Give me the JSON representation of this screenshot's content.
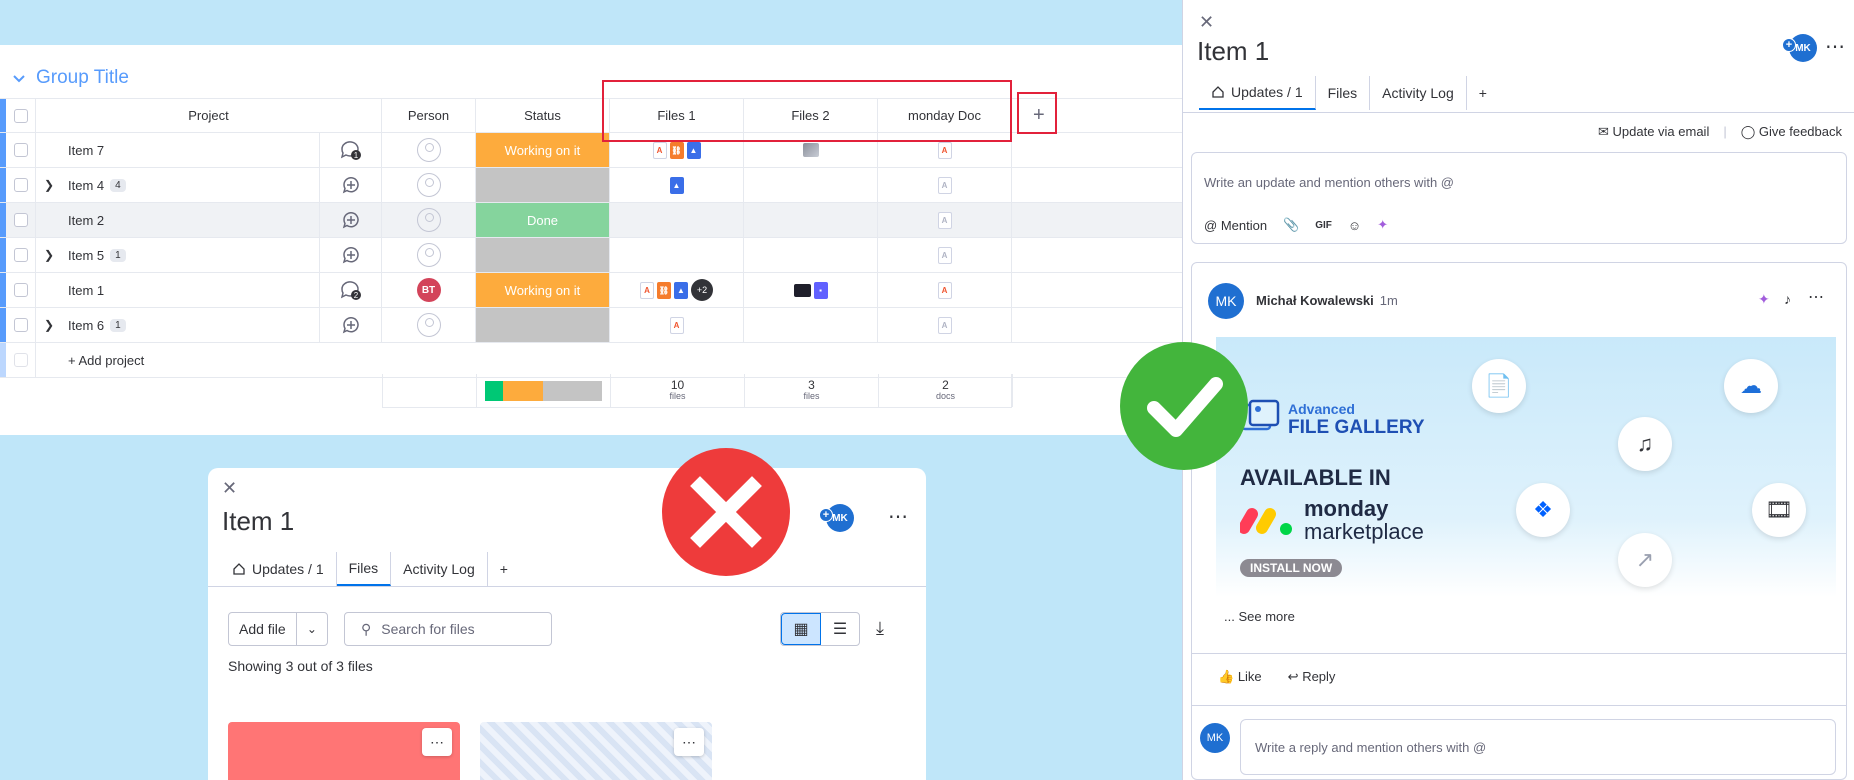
{
  "board": {
    "group_title": "Group Title",
    "columns": [
      "Project",
      "Person",
      "Status",
      "Files 1",
      "Files 2",
      "monday Doc"
    ],
    "rows": [
      {
        "name": "Item 7",
        "count": "",
        "expandable": false,
        "updates": "1",
        "person": "",
        "status": "Working on it"
      },
      {
        "name": "Item 4",
        "count": "4",
        "expandable": true,
        "updates": "",
        "person": "",
        "status": ""
      },
      {
        "name": "Item 2",
        "count": "",
        "expandable": false,
        "updates": "",
        "person": "",
        "status": "Done"
      },
      {
        "name": "Item 5",
        "count": "1",
        "expandable": true,
        "updates": "",
        "person": "",
        "status": ""
      },
      {
        "name": "Item 1",
        "count": "",
        "expandable": false,
        "updates": "2",
        "person": "BT",
        "status": "Working on it",
        "extra_files": "+2"
      },
      {
        "name": "Item 6",
        "count": "1",
        "expandable": true,
        "updates": "",
        "person": "",
        "status": ""
      }
    ],
    "add_project": "+ Add project",
    "footer": {
      "files1_count": "10",
      "files1_unit": "files",
      "files2_count": "3",
      "files2_unit": "files",
      "doc_count": "2",
      "doc_unit": "docs"
    },
    "colors": {
      "accent": "#579bfc",
      "working": "#fdab3d",
      "done": "#85d49d",
      "empty": "#c4c4c4",
      "highlight": "#e2213b"
    }
  },
  "right_panel": {
    "title": "Item 1",
    "badge": "MK",
    "tabs": [
      "Updates / 1",
      "Files",
      "Activity Log",
      "+"
    ],
    "update_via_email": "Update via email",
    "give_feedback": "Give feedback",
    "composer_placeholder": "Write an update and mention others with @",
    "mention_label": "Mention",
    "gif_label": "GIF",
    "post": {
      "avatar": "MK",
      "author": "Michał Kowalewski",
      "time": "1m",
      "banner_line1": "Advanced",
      "banner_line2": "FILE GALLERY",
      "banner_line3": "AVAILABLE IN",
      "banner_brand1": "monday",
      "banner_brand2": "marketplace",
      "banner_cta": "INSTALL NOW",
      "see_more": "... See more",
      "like": "Like",
      "reply": "Reply",
      "reply_placeholder": "Write a reply and mention others with @"
    }
  },
  "bottom_card": {
    "title": "Item 1",
    "badge": "MK",
    "tabs": [
      "Updates / 1",
      "Files",
      "Activity Log",
      "+"
    ],
    "add_file": "Add file",
    "search_placeholder": "Search for files",
    "showing": "Showing 3 out of 3 files"
  }
}
